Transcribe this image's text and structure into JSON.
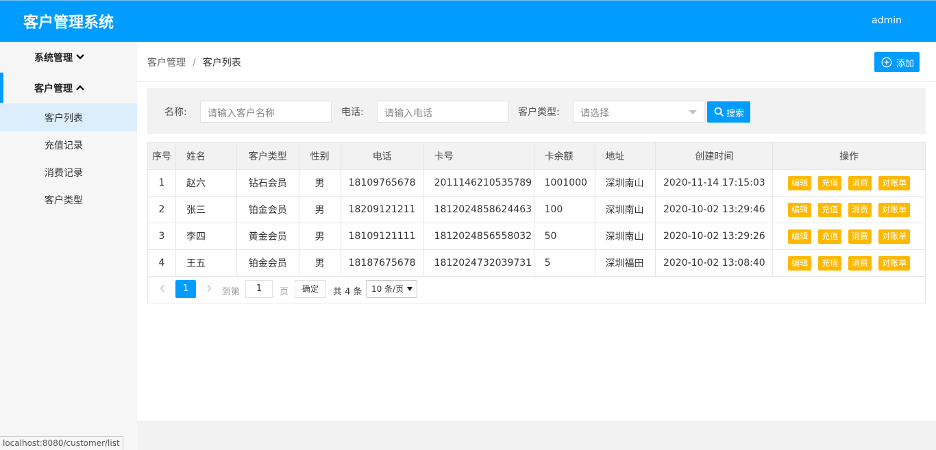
{
  "app": {
    "title": "客户管理系统",
    "user": "admin"
  },
  "sidebar": {
    "groups": [
      {
        "label": "系统管理"
      },
      {
        "label": "客户管理"
      }
    ],
    "items": [
      {
        "label": "客户列表"
      },
      {
        "label": "充值记录"
      },
      {
        "label": "消费记录"
      },
      {
        "label": "客户类型"
      }
    ]
  },
  "breadcrumb": {
    "parent": "客户管理",
    "separator": "/",
    "current": "客户列表"
  },
  "toolbar": {
    "add_label": "添加"
  },
  "search": {
    "name_label": "名称:",
    "name_placeholder": "请输入客户名称",
    "phone_label": "电话:",
    "phone_placeholder": "请输入电话",
    "type_label": "客户类型:",
    "type_value": "请选择",
    "button_label": "搜索"
  },
  "table": {
    "columns": [
      "序号",
      "姓名",
      "客户类型",
      "性别",
      "电话",
      "卡号",
      "卡余额",
      "地址",
      "创建时间",
      "操作"
    ],
    "rows": [
      {
        "no": "1",
        "name": "赵六",
        "type": "钻石会员",
        "gender": "男",
        "phone": "18109765678",
        "card": "2011146210535789",
        "balance": "1001000",
        "address": "深圳南山",
        "created": "2020-11-14 17:15:03"
      },
      {
        "no": "2",
        "name": "张三",
        "type": "铂金会员",
        "gender": "男",
        "phone": "18209121211",
        "card": "1812024858624463",
        "balance": "100",
        "address": "深圳南山",
        "created": "2020-10-02 13:29:46"
      },
      {
        "no": "3",
        "name": "李四",
        "type": "黄金会员",
        "gender": "男",
        "phone": "18109121111",
        "card": "1812024856558032",
        "balance": "50",
        "address": "深圳南山",
        "created": "2020-10-02 13:29:26"
      },
      {
        "no": "4",
        "name": "王五",
        "type": "铂金会员",
        "gender": "男",
        "phone": "18187675678",
        "card": "1812024732039731",
        "balance": "5",
        "address": "深圳福田",
        "created": "2020-10-02 13:08:40"
      }
    ],
    "actions": {
      "edit": "编辑",
      "recharge": "充值",
      "consume": "消费",
      "statement": "对账单"
    }
  },
  "pager": {
    "current": "1",
    "goto_label": "到第",
    "page_value": "1",
    "page_unit": "页",
    "confirm_label": "确定",
    "total_text": "共 4 条",
    "page_size": "10 条/页"
  },
  "status_url": "localhost:8080/customer/list",
  "colors": {
    "primary": "#009cff",
    "warning": "#ffb800",
    "sidebar_bg": "#f6f6f6"
  }
}
